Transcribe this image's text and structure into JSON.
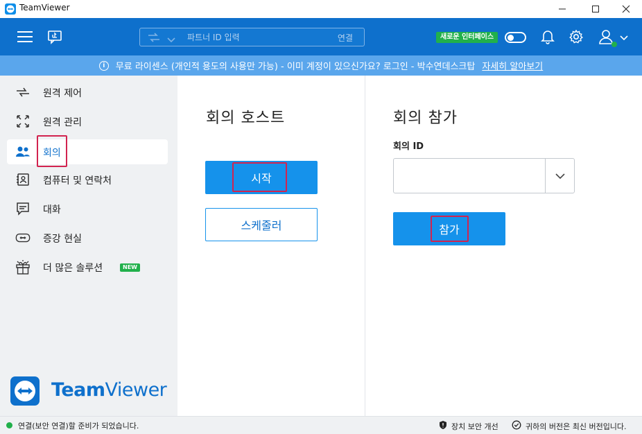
{
  "window": {
    "title": "TeamViewer",
    "minimize": "—",
    "maximize": "☐",
    "close": "✕"
  },
  "toolbar": {
    "search_placeholder": "파트너 ID 입력",
    "connect_label": "연결",
    "new_ui_badge": "새로운 인터페이스",
    "new_ui_toggle": "off"
  },
  "infobar": {
    "message": "무료 라이센스 (개인적 용도의 사용만 가능) - 이미 계정이 있으신가요? 로그인 - 박수연데스크탑",
    "link": "자세히 알아보기"
  },
  "sidebar": {
    "items": [
      {
        "label": "원격 제어",
        "icon": "remote-control-icon"
      },
      {
        "label": "원격 관리",
        "icon": "remote-management-icon"
      },
      {
        "label": "회의",
        "icon": "meeting-icon",
        "active": true
      },
      {
        "label": "컴퓨터 및 연락처",
        "icon": "contacts-icon"
      },
      {
        "label": "대화",
        "icon": "chat-icon"
      },
      {
        "label": "증강 현실",
        "icon": "ar-icon"
      },
      {
        "label": "더 많은 솔루션",
        "icon": "gift-icon",
        "badge": "NEW"
      }
    ]
  },
  "brand": {
    "word_bold": "Team",
    "word_light": "Viewer"
  },
  "host": {
    "title": "회의 호스트",
    "start_label": "시작",
    "scheduler_label": "스케줄러"
  },
  "join": {
    "title": "회의 참가",
    "id_label": "회의 ID",
    "id_value": "",
    "join_label": "참가"
  },
  "status": {
    "connection": "연결(보안 연결)할 준비가 되었습니다.",
    "device_security": "장치 보안 개선",
    "version": "귀하의 버전은 최신 버전입니다."
  },
  "colors": {
    "brand_blue": "#0e70cc",
    "button_blue": "#1592eb",
    "info_blue": "#5aa6ec",
    "ready_green": "#21b04b",
    "highlight_red": "#d2234f"
  }
}
